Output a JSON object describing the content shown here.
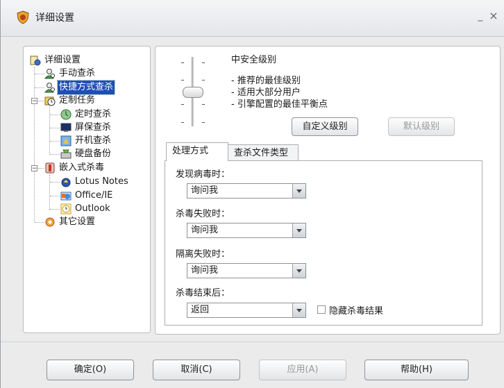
{
  "window": {
    "title": "详细设置",
    "minimize": "_",
    "close": "×"
  },
  "tree": {
    "root": "详细设置",
    "items": [
      {
        "label": "手动查杀"
      },
      {
        "label": "快捷方式查杀"
      },
      {
        "label": "定制任务"
      },
      {
        "label": "定时查杀"
      },
      {
        "label": "屏保查杀"
      },
      {
        "label": "开机查杀"
      },
      {
        "label": "硬盘备份"
      },
      {
        "label": "嵌入式杀毒"
      },
      {
        "label": "Lotus Notes"
      },
      {
        "label": "Office/IE"
      },
      {
        "label": "Outlook"
      },
      {
        "label": "其它设置"
      }
    ],
    "selected_index": 1,
    "expand_signs": [
      "−",
      "−",
      "−"
    ]
  },
  "security": {
    "level_title": "中安全级别",
    "details": [
      "- 推荐的最佳级别",
      "- 适用大部分用户",
      "- 引擎配置的最佳平衡点"
    ],
    "slider_level": 2,
    "slider_levels": 4,
    "custom_button": "自定义级别",
    "default_button": "默认级别"
  },
  "tabs": [
    "处理方式",
    "查杀文件类型"
  ],
  "active_tab": 0,
  "fields": [
    {
      "label": "发现病毒时：",
      "value": "询问我"
    },
    {
      "label": "杀毒失败时：",
      "value": "询问我"
    },
    {
      "label": "隔离失败时：",
      "value": "询问我"
    },
    {
      "label": "杀毒结束后：",
      "value": "返回"
    }
  ],
  "hide_results": {
    "label": "隐藏杀毒结果",
    "checked": false
  },
  "footer": {
    "ok": "确定(O)",
    "cancel": "取消(C)",
    "apply": "应用(A)",
    "help": "帮助(H)"
  },
  "colors": {
    "selection": "#1e4fb4",
    "window_bg": "#ebebeb"
  }
}
